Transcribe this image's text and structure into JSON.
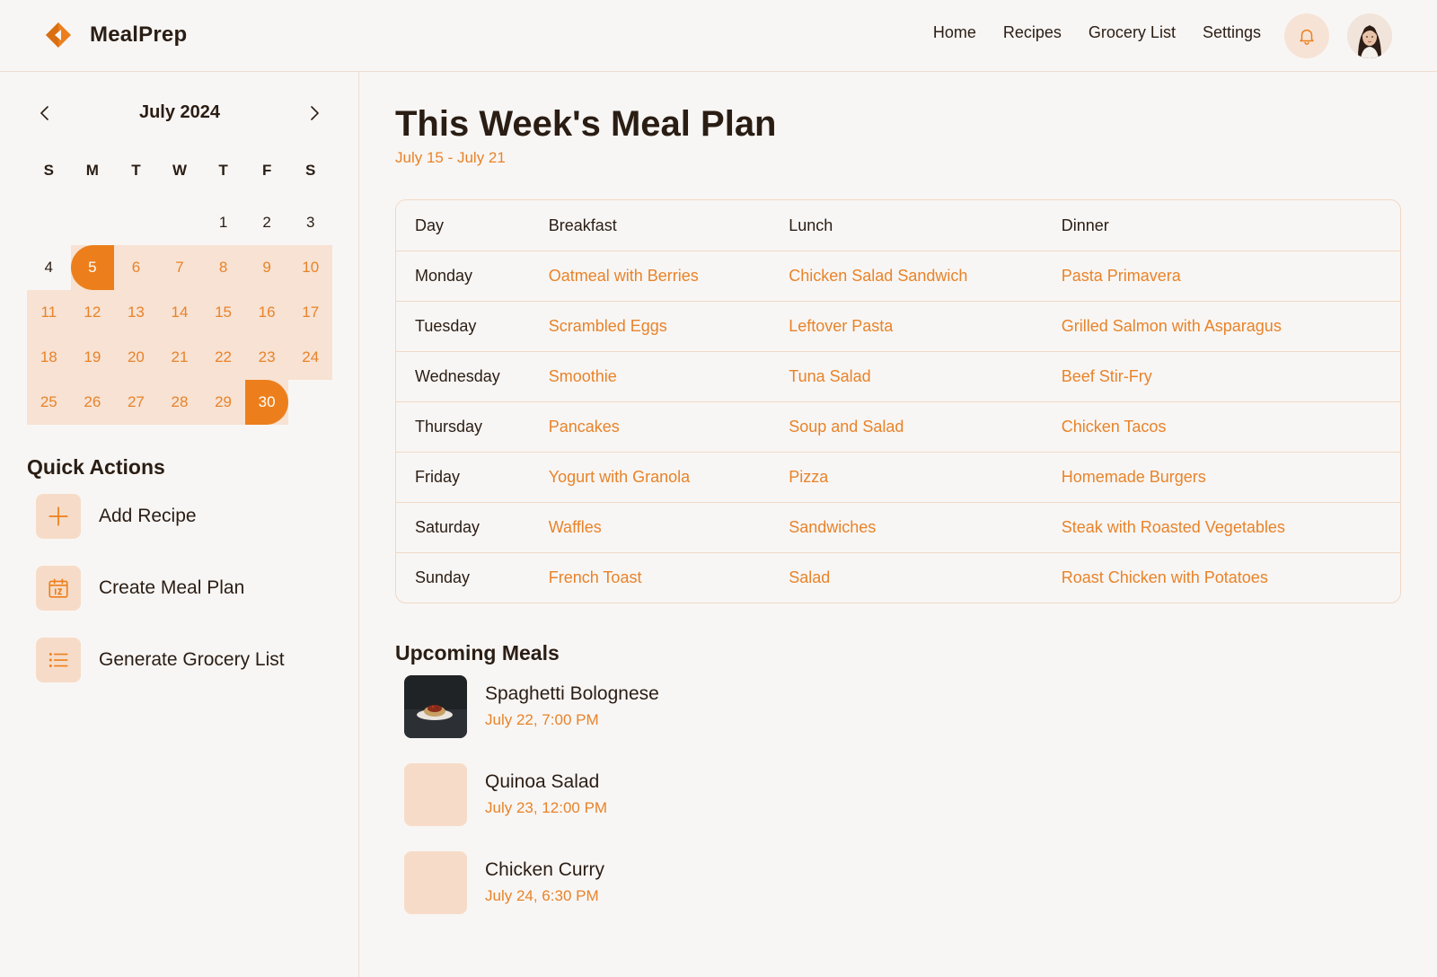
{
  "app": {
    "name": "MealPrep"
  },
  "nav": {
    "items": [
      "Home",
      "Recipes",
      "Grocery List",
      "Settings"
    ]
  },
  "colors": {
    "accent": "#ec7f1c",
    "accent_light": "#f7e2d3",
    "text": "#2a1d14",
    "background": "#f8f6f4"
  },
  "icons": {
    "logo": "diamond-logo",
    "bell": "bell-icon",
    "avatar": "user-avatar"
  },
  "calendar": {
    "title": "July 2024",
    "weekdays": [
      "S",
      "M",
      "T",
      "W",
      "T",
      "F",
      "S"
    ],
    "leading_blanks": 4,
    "days": [
      "1",
      "2",
      "3",
      "4",
      "5",
      "6",
      "7",
      "8",
      "9",
      "10",
      "11",
      "12",
      "13",
      "14",
      "15",
      "16",
      "17",
      "18",
      "19",
      "20",
      "21",
      "22",
      "23",
      "24",
      "25",
      "26",
      "27",
      "28",
      "29",
      "30"
    ],
    "range_start": 5,
    "range_end": 30
  },
  "quick_actions": {
    "title": "Quick Actions",
    "items": [
      {
        "label": "Add Recipe",
        "icon": "plus-icon"
      },
      {
        "label": "Create Meal Plan",
        "icon": "calendar-icon"
      },
      {
        "label": "Generate Grocery List",
        "icon": "list-icon"
      }
    ]
  },
  "main": {
    "title": "This Week's Meal Plan",
    "subtitle": "July 15 - July 21",
    "table": {
      "headers": [
        "Day",
        "Breakfast",
        "Lunch",
        "Dinner"
      ],
      "rows": [
        [
          "Monday",
          "Oatmeal with Berries",
          "Chicken Salad Sandwich",
          "Pasta Primavera"
        ],
        [
          "Tuesday",
          "Scrambled Eggs",
          "Leftover Pasta",
          "Grilled Salmon with Asparagus"
        ],
        [
          "Wednesday",
          "Smoothie",
          "Tuna Salad",
          "Beef Stir-Fry"
        ],
        [
          "Thursday",
          "Pancakes",
          "Soup and Salad",
          "Chicken Tacos"
        ],
        [
          "Friday",
          "Yogurt with Granola",
          "Pizza",
          "Homemade Burgers"
        ],
        [
          "Saturday",
          "Waffles",
          "Sandwiches",
          "Steak with Roasted Vegetables"
        ],
        [
          "Sunday",
          "French Toast",
          "Salad",
          "Roast Chicken with Potatoes"
        ]
      ]
    },
    "upcoming": {
      "title": "Upcoming Meals",
      "items": [
        {
          "name": "Spaghetti Bolognese",
          "time": "July 22, 7:00 PM",
          "has_photo": true
        },
        {
          "name": "Quinoa Salad",
          "time": "July 23, 12:00 PM",
          "has_photo": false
        },
        {
          "name": "Chicken Curry",
          "time": "July 24, 6:30 PM",
          "has_photo": false
        }
      ]
    }
  }
}
